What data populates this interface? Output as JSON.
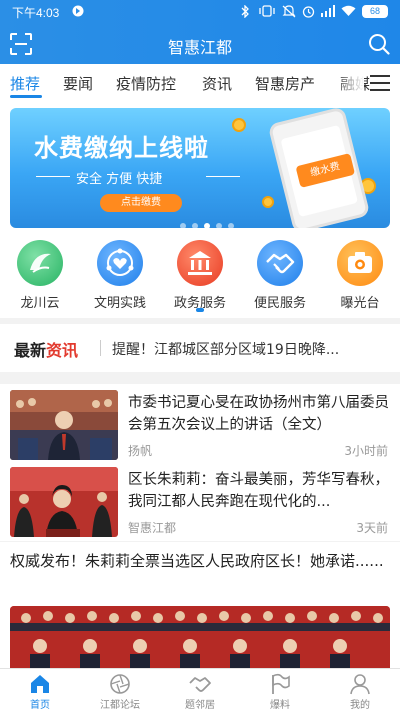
{
  "status_bar": {
    "time": "下午4:03",
    "battery": "68"
  },
  "header": {
    "title": "智惠江都"
  },
  "tabs": [
    {
      "label": "推荐",
      "active": true
    },
    {
      "label": "要闻"
    },
    {
      "label": "疫情防控"
    },
    {
      "label": "资讯"
    },
    {
      "label": "智惠房产"
    },
    {
      "label": "融媒"
    }
  ],
  "banner": {
    "title": "水费缴纳上线啦",
    "subtitle": "安全  方便  快捷",
    "button": "点击缴费",
    "phone_label": "缴水费"
  },
  "quick_links": [
    {
      "label": "龙川云",
      "icon": "longchuan-cloud-icon",
      "color": "#3cc47a"
    },
    {
      "label": "文明实践",
      "icon": "heart-network-icon",
      "color": "#2f8ef0"
    },
    {
      "label": "政务服务",
      "icon": "government-building-icon",
      "color": "#f0532e"
    },
    {
      "label": "便民服务",
      "icon": "handshake-icon",
      "color": "#2f8ef0"
    },
    {
      "label": "曝光台",
      "icon": "camera-icon",
      "color": "#ff9a1e"
    }
  ],
  "ticker": {
    "brand_a": "最新",
    "brand_b": "资讯",
    "text": "提醒！江都城区部分区域19日晚降..."
  },
  "news": [
    {
      "title": "市委书记夏心旻在政协扬州市第八届委员会第五次会议上的讲话（全文）",
      "source": "扬帆",
      "ago": "3小时前"
    },
    {
      "title": "区长朱莉莉：奋斗最美丽，芳华写春秋，我同江都人民奔跑在现代化的...",
      "source": "智惠江都",
      "ago": "3天前"
    }
  ],
  "featured": {
    "title": "权威发布！朱莉莉全票当选区人民政府区长！她承诺......"
  },
  "bottom_nav": [
    {
      "label": "首页",
      "icon": "home-icon",
      "active": true
    },
    {
      "label": "江都论坛",
      "icon": "forum-icon"
    },
    {
      "label": "题邻居",
      "icon": "neighbor-handshake-icon"
    },
    {
      "label": "爆料",
      "icon": "flag-icon"
    },
    {
      "label": "我的",
      "icon": "user-icon"
    }
  ],
  "colors": {
    "brand_blue": "#1a86e6",
    "header_blue": "#2b8fe6",
    "accent_red": "#e23a2e"
  }
}
